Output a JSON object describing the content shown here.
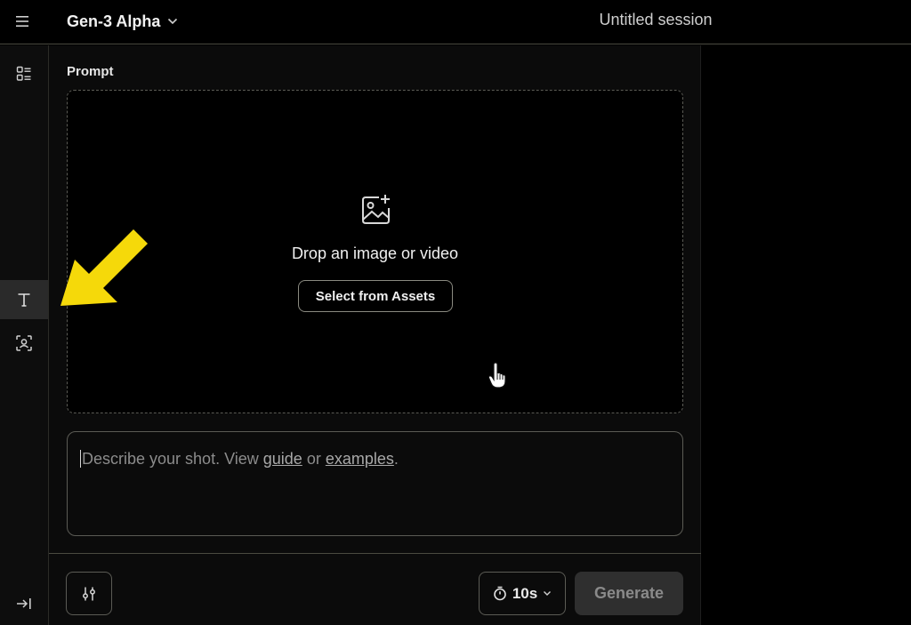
{
  "header": {
    "model_name": "Gen-3 Alpha",
    "session_title": "Untitled session",
    "icons": [
      "menu-icon",
      "chevron-down-icon"
    ]
  },
  "sidebar": {
    "items": [
      {
        "name": "assets-grid",
        "icon": "grid-list-icon"
      },
      {
        "name": "text",
        "icon": "text-t-icon",
        "active": true
      },
      {
        "name": "face",
        "icon": "face-scan-icon"
      },
      {
        "name": "expand",
        "icon": "arrow-to-right-icon"
      }
    ]
  },
  "main": {
    "prompt_label": "Prompt",
    "dropzone": {
      "text": "Drop an image or video",
      "button_label": "Select from Assets",
      "icon": "image-plus-icon"
    },
    "prompt_input": {
      "placeholder_prefix": "Describe your shot. View ",
      "guide_link": "guide",
      "or_text": " or ",
      "examples_link": "examples",
      "suffix": "."
    },
    "footer": {
      "settings_icon": "sliders-icon",
      "duration_label": "10s",
      "duration_icon": "timer-icon",
      "generate_label": "Generate"
    }
  },
  "colors": {
    "background": "#000000",
    "panel": "#0b0b0b",
    "border": "#5b5b55",
    "annotation_arrow": "#f5d90a",
    "generate_bg": "#2f2f2f"
  }
}
